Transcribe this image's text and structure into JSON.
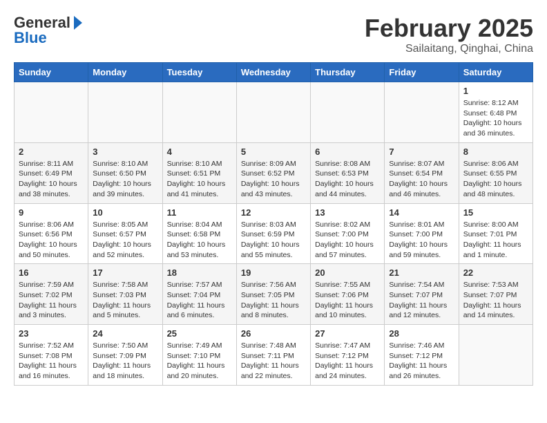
{
  "header": {
    "logo_general": "General",
    "logo_blue": "Blue",
    "month": "February 2025",
    "location": "Sailaitang, Qinghai, China"
  },
  "weekdays": [
    "Sunday",
    "Monday",
    "Tuesday",
    "Wednesday",
    "Thursday",
    "Friday",
    "Saturday"
  ],
  "weeks": [
    [
      {
        "day": "",
        "info": ""
      },
      {
        "day": "",
        "info": ""
      },
      {
        "day": "",
        "info": ""
      },
      {
        "day": "",
        "info": ""
      },
      {
        "day": "",
        "info": ""
      },
      {
        "day": "",
        "info": ""
      },
      {
        "day": "1",
        "info": "Sunrise: 8:12 AM\nSunset: 6:48 PM\nDaylight: 10 hours and 36 minutes."
      }
    ],
    [
      {
        "day": "2",
        "info": "Sunrise: 8:11 AM\nSunset: 6:49 PM\nDaylight: 10 hours and 38 minutes."
      },
      {
        "day": "3",
        "info": "Sunrise: 8:10 AM\nSunset: 6:50 PM\nDaylight: 10 hours and 39 minutes."
      },
      {
        "day": "4",
        "info": "Sunrise: 8:10 AM\nSunset: 6:51 PM\nDaylight: 10 hours and 41 minutes."
      },
      {
        "day": "5",
        "info": "Sunrise: 8:09 AM\nSunset: 6:52 PM\nDaylight: 10 hours and 43 minutes."
      },
      {
        "day": "6",
        "info": "Sunrise: 8:08 AM\nSunset: 6:53 PM\nDaylight: 10 hours and 44 minutes."
      },
      {
        "day": "7",
        "info": "Sunrise: 8:07 AM\nSunset: 6:54 PM\nDaylight: 10 hours and 46 minutes."
      },
      {
        "day": "8",
        "info": "Sunrise: 8:06 AM\nSunset: 6:55 PM\nDaylight: 10 hours and 48 minutes."
      }
    ],
    [
      {
        "day": "9",
        "info": "Sunrise: 8:06 AM\nSunset: 6:56 PM\nDaylight: 10 hours and 50 minutes."
      },
      {
        "day": "10",
        "info": "Sunrise: 8:05 AM\nSunset: 6:57 PM\nDaylight: 10 hours and 52 minutes."
      },
      {
        "day": "11",
        "info": "Sunrise: 8:04 AM\nSunset: 6:58 PM\nDaylight: 10 hours and 53 minutes."
      },
      {
        "day": "12",
        "info": "Sunrise: 8:03 AM\nSunset: 6:59 PM\nDaylight: 10 hours and 55 minutes."
      },
      {
        "day": "13",
        "info": "Sunrise: 8:02 AM\nSunset: 7:00 PM\nDaylight: 10 hours and 57 minutes."
      },
      {
        "day": "14",
        "info": "Sunrise: 8:01 AM\nSunset: 7:00 PM\nDaylight: 10 hours and 59 minutes."
      },
      {
        "day": "15",
        "info": "Sunrise: 8:00 AM\nSunset: 7:01 PM\nDaylight: 11 hours and 1 minute."
      }
    ],
    [
      {
        "day": "16",
        "info": "Sunrise: 7:59 AM\nSunset: 7:02 PM\nDaylight: 11 hours and 3 minutes."
      },
      {
        "day": "17",
        "info": "Sunrise: 7:58 AM\nSunset: 7:03 PM\nDaylight: 11 hours and 5 minutes."
      },
      {
        "day": "18",
        "info": "Sunrise: 7:57 AM\nSunset: 7:04 PM\nDaylight: 11 hours and 6 minutes."
      },
      {
        "day": "19",
        "info": "Sunrise: 7:56 AM\nSunset: 7:05 PM\nDaylight: 11 hours and 8 minutes."
      },
      {
        "day": "20",
        "info": "Sunrise: 7:55 AM\nSunset: 7:06 PM\nDaylight: 11 hours and 10 minutes."
      },
      {
        "day": "21",
        "info": "Sunrise: 7:54 AM\nSunset: 7:07 PM\nDaylight: 11 hours and 12 minutes."
      },
      {
        "day": "22",
        "info": "Sunrise: 7:53 AM\nSunset: 7:07 PM\nDaylight: 11 hours and 14 minutes."
      }
    ],
    [
      {
        "day": "23",
        "info": "Sunrise: 7:52 AM\nSunset: 7:08 PM\nDaylight: 11 hours and 16 minutes."
      },
      {
        "day": "24",
        "info": "Sunrise: 7:50 AM\nSunset: 7:09 PM\nDaylight: 11 hours and 18 minutes."
      },
      {
        "day": "25",
        "info": "Sunrise: 7:49 AM\nSunset: 7:10 PM\nDaylight: 11 hours and 20 minutes."
      },
      {
        "day": "26",
        "info": "Sunrise: 7:48 AM\nSunset: 7:11 PM\nDaylight: 11 hours and 22 minutes."
      },
      {
        "day": "27",
        "info": "Sunrise: 7:47 AM\nSunset: 7:12 PM\nDaylight: 11 hours and 24 minutes."
      },
      {
        "day": "28",
        "info": "Sunrise: 7:46 AM\nSunset: 7:12 PM\nDaylight: 11 hours and 26 minutes."
      },
      {
        "day": "",
        "info": ""
      }
    ]
  ]
}
